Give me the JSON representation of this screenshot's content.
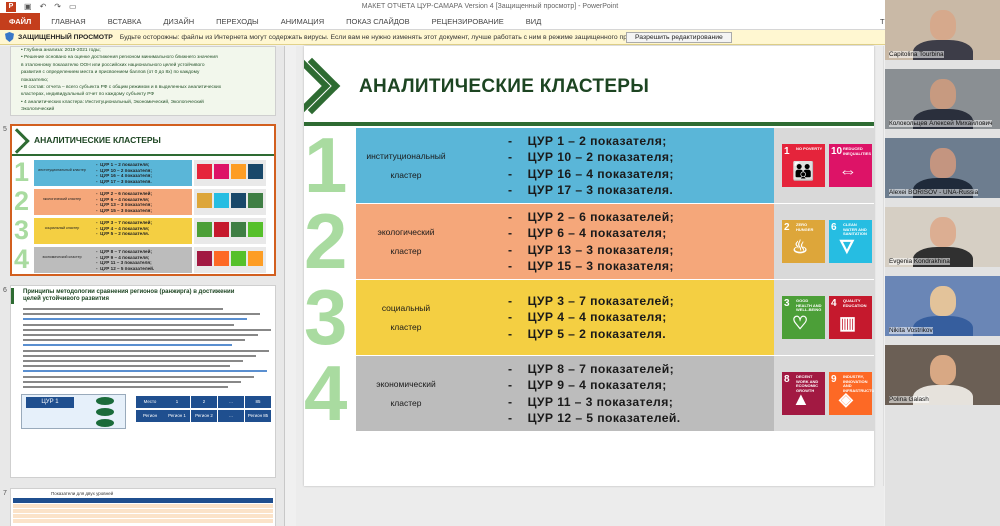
{
  "window": {
    "title": "МАКЕТ ОТЧЕТА ЦУР-САМАРА Version 4 [Защищенный просмотр] - PowerPoint",
    "app_icon": "P"
  },
  "ribbon": {
    "tabs": [
      "ФАЙЛ",
      "ГЛАВНАЯ",
      "ВСТАВКА",
      "ДИЗАЙН",
      "ПЕРЕХОДЫ",
      "АНИМАЦИЯ",
      "ПОКАЗ СЛАЙДОВ",
      "РЕЦЕНЗИРОВАНИЕ",
      "ВИД"
    ],
    "trailing": "Т"
  },
  "protected_view": {
    "title": "ЗАЩИЩЕННЫЙ ПРОСМОТР",
    "message": "Будьте осторожны: файлы из Интернета могут содержать вирусы. Если вам не нужно изменять этот документ, лучше работать с ним в режиме защищенного просмотра.",
    "button": "Разрешить редактирование"
  },
  "thumbnails": {
    "slide4_lines": [
      "• Глубина анализа: 2019-2021 годы;",
      "• Решение основано на оценке достижения регионом минимального ближнего значения",
      "  в эталонному показателю ООН или российских национального целей устойчивого",
      "  развития с определением места и присвоением баллов (от 0 до 8х) по каждому",
      "  показателю;",
      "• В состав: отчета – всего субъекта РФ с общим режимом и в выделенных аналитических",
      "  кластерах, индивидуальный отчет по каждому субъекту РФ",
      "• 4 аналитических кластера: Институциональный, Экономический, Экологический",
      "  Экологический"
    ],
    "slide5_number": "5",
    "slide5_title": "АНАЛИТИЧЕСКИЕ КЛАСТЕРЫ",
    "slide6_number": "6",
    "slide6_title": "Принципы методологии сравнения регионов (ранжирга) в достижении целей устойчивого развития",
    "slide7_number": "7",
    "slide7_header": "Показатели для двух уровней",
    "diagram_label": "ЦУР 1",
    "rank_table": {
      "row1": [
        "Место",
        "1",
        "2",
        "...",
        "85"
      ],
      "row2": [
        "Регион",
        "Регион 1",
        "Регион 2",
        "...",
        "Регион 85"
      ]
    }
  },
  "slide": {
    "title": "АНАЛИТИЧЕСКИЕ КЛАСТЕРЫ",
    "clusters": [
      {
        "number": "1",
        "label": [
          "институциональный",
          "кластер"
        ],
        "items": [
          "ЦУР 1 – 2 показателя;",
          "ЦУР 10 – 2 показателя;",
          "ЦУР 16 – 4 показателя;",
          "ЦУР 17 – 3 показателя."
        ],
        "color": "#5ab6d8",
        "icons": [
          {
            "num": "1",
            "label": "NO POVERTY",
            "color": "#e5243b",
            "glyph": "👪"
          },
          {
            "num": "10",
            "label": "REDUCED INEQUALITIES",
            "color": "#dd1367",
            "glyph": "⇔"
          }
        ]
      },
      {
        "number": "2",
        "label": [
          "экологический",
          "кластер"
        ],
        "items": [
          "ЦУР 2 – 6 показателей;",
          "ЦУР 6 – 4 показателя;",
          "ЦУР 13 – 3 показателя;",
          "ЦУР 15 – 3 показателя;"
        ],
        "color": "#f5a77a",
        "icons": [
          {
            "num": "2",
            "label": "ZERO HUNGER",
            "color": "#dda63a",
            "glyph": "♨"
          },
          {
            "num": "6",
            "label": "CLEAN WATER AND SANITATION",
            "color": "#26bde2",
            "glyph": "🜄"
          }
        ]
      },
      {
        "number": "3",
        "label": [
          "социальный",
          "кластер"
        ],
        "items": [
          "ЦУР 3 – 7 показателей;",
          "ЦУР 4 – 4 показателя;",
          "ЦУР 5 – 2 показателя."
        ],
        "color": "#f4cf42",
        "icons": [
          {
            "num": "3",
            "label": "GOOD HEALTH AND WELL-BEING",
            "color": "#4c9f38",
            "glyph": "♡"
          },
          {
            "num": "4",
            "label": "QUALITY EDUCATION",
            "color": "#c5192d",
            "glyph": "▥"
          }
        ]
      },
      {
        "number": "4",
        "label": [
          "экономический",
          "кластер"
        ],
        "items": [
          "ЦУР 8 – 7 показателей;",
          "ЦУР 9 – 4 показателя;",
          "ЦУР 11 – 3 показателя;",
          "ЦУР 12 – 5 показателей."
        ],
        "color": "#bcbcbc",
        "icons": [
          {
            "num": "8",
            "label": "DECENT WORK AND ECONOMIC GROWTH",
            "color": "#a21942",
            "glyph": "▲"
          },
          {
            "num": "9",
            "label": "INDUSTRY, INNOVATION AND INFRASTRUCTURE",
            "color": "#fd6925",
            "glyph": "◈"
          }
        ]
      }
    ]
  },
  "participants": [
    {
      "name": "Capitolina Tourbina",
      "bg": "#c9b9a6",
      "skin": "#d6a98c",
      "shirt": "#3d3d48"
    },
    {
      "name": "Колокольцев Алексей Михайлович",
      "bg": "#8a8f93",
      "skin": "#c79a80",
      "shirt": "#2a2f3c"
    },
    {
      "name": "Alexei BORISOV - UNA-Russia",
      "bg": "#6d7d8f",
      "skin": "#c49580",
      "shirt": "#1f2a3a"
    },
    {
      "name": "Evgenia Kondrakhina",
      "bg": "#d6cfc4",
      "skin": "#dcae92",
      "shirt": "#303030"
    },
    {
      "name": "Nikita Vostrikov",
      "bg": "#6a86b6",
      "skin": "#e3c39a",
      "shirt": "#365e9e"
    },
    {
      "name": "Polina Galash",
      "bg": "#6b5f55",
      "skin": "#d8a884",
      "shirt": "#e6e2dc"
    }
  ]
}
